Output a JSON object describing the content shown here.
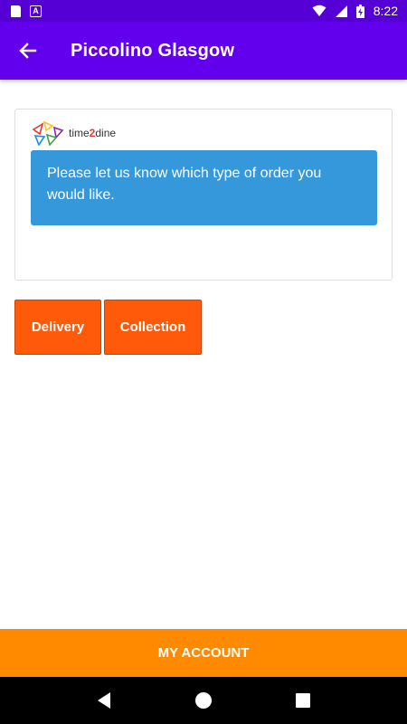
{
  "status_bar": {
    "time": "8:22",
    "icons": [
      "sd-card-icon",
      "a-icon",
      "wifi-icon",
      "signal-icon",
      "battery-charging-icon"
    ],
    "a_icon_letter": "A"
  },
  "app_bar": {
    "title": "Piccolino Glasgow",
    "background": "#6200ee",
    "back_icon": "arrow-back-icon"
  },
  "card": {
    "logo": {
      "prefix": "time",
      "two": "2",
      "suffix": "dine"
    },
    "message": "Please let us know which type of order you would like.",
    "message_background": "#3498db"
  },
  "order_type": {
    "buttons": [
      {
        "label": "Delivery"
      },
      {
        "label": "Collection"
      }
    ],
    "button_color": "#ff5a0a"
  },
  "bottom_bar": {
    "label": "MY ACCOUNT",
    "background": "#ff8a00"
  },
  "nav_bar": {
    "icons": [
      "nav-back-icon",
      "nav-home-icon",
      "nav-recents-icon"
    ]
  }
}
